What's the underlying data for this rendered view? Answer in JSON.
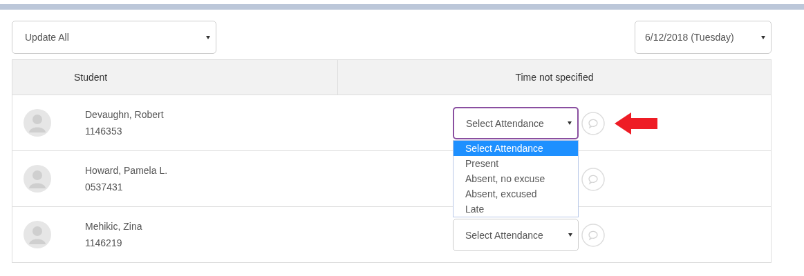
{
  "update_select": {
    "value": "Update All"
  },
  "date_select": {
    "value": "6/12/2018 (Tuesday)"
  },
  "table": {
    "columns": [
      "Student",
      "Time not specified"
    ],
    "rows": [
      {
        "name": "Devaughn, Robert",
        "id": "1146353",
        "attendance": {
          "value": "Select Attendance",
          "open": true
        }
      },
      {
        "name": "Howard, Pamela L.",
        "id": "0537431"
      },
      {
        "name": "Mehikic, Zina",
        "id": "1146219",
        "attendance": {
          "value": "Select Attendance",
          "open": false
        }
      }
    ]
  },
  "attendance_options": [
    {
      "label": "Select Attendance",
      "selected": true
    },
    {
      "label": "Present",
      "selected": false
    },
    {
      "label": "Absent, no excuse",
      "selected": false
    },
    {
      "label": "Absent, excused",
      "selected": false
    },
    {
      "label": "Late",
      "selected": false
    }
  ]
}
